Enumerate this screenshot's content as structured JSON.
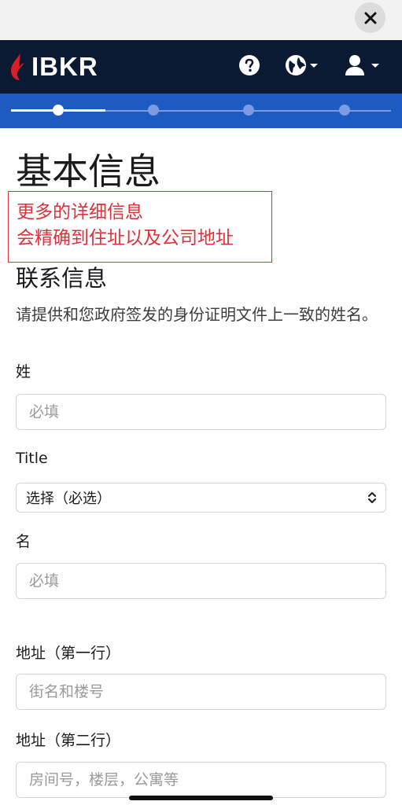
{
  "header": {
    "logo_text": "IBKR",
    "icons": [
      "help-icon",
      "globe-icon",
      "user-icon"
    ],
    "colors": {
      "navy": "#0b1a33",
      "brand_red": "#d81f26",
      "progress_blue": "#1d5bc2"
    }
  },
  "progress": {
    "steps": 4,
    "current_step": 1
  },
  "page": {
    "title": "基本信息",
    "annotation_lines": [
      "更多的详细信息",
      "会精确到住址以及公司地址"
    ],
    "section_title": "联系信息",
    "description": "请提供和您政府签发的身份证明文件上一致的姓名。"
  },
  "form": {
    "last_name": {
      "label": "姓",
      "placeholder": "必填",
      "value": ""
    },
    "title": {
      "label": "Title",
      "selected": "选择（必选）"
    },
    "first_name": {
      "label": "名",
      "placeholder": "必填",
      "value": ""
    },
    "address1": {
      "label": "地址（第一行）",
      "placeholder": "街名和楼号",
      "value": ""
    },
    "address2": {
      "label": "地址（第二行）",
      "placeholder": "房间号，楼层，公寓等",
      "value": ""
    }
  }
}
